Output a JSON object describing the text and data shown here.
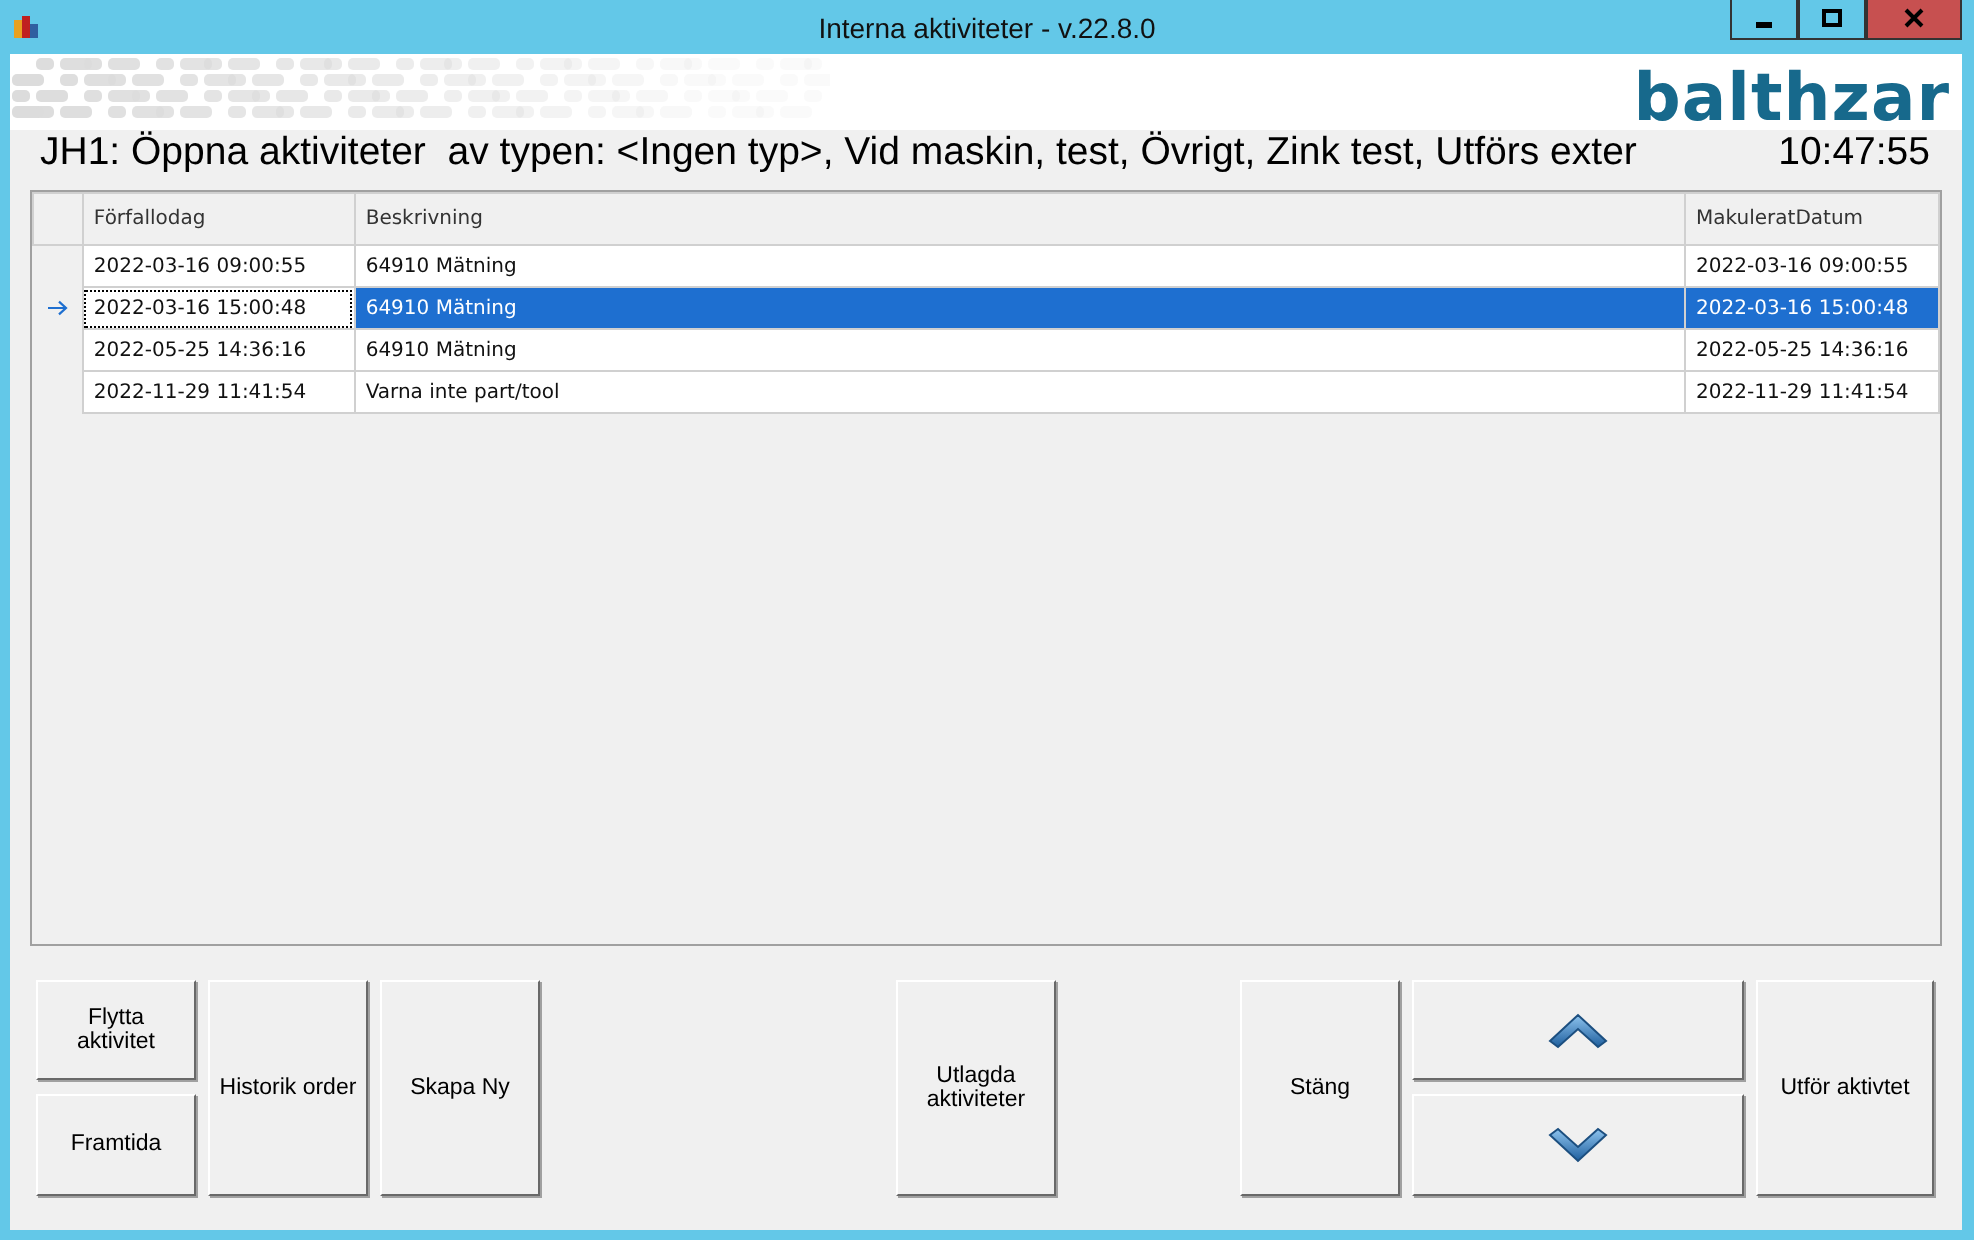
{
  "window": {
    "title": "Interna aktiviteter - v.22.8.0",
    "controls": [
      {
        "kind": "minimize"
      },
      {
        "kind": "maximize"
      },
      {
        "kind": "close"
      }
    ]
  },
  "logo": "balthzar",
  "heading": "JH1: Öppna aktiviteter  av typen: <Ingen typ>, Vid maskin, test, Övrigt, Zink test, Utförs exter",
  "clock": "10:47:55",
  "table": {
    "columns": [
      "Förfallodag",
      "Beskrivning",
      "MakuleratDatum"
    ],
    "rows": [
      {
        "cells": [
          "2022-03-16 09:00:55",
          "64910 Mätning",
          "2022-03-16 09:00:55"
        ],
        "selected": false
      },
      {
        "cells": [
          "2022-03-16 15:00:48",
          "64910 Mätning",
          "2022-03-16 15:00:48"
        ],
        "selected": true
      },
      {
        "cells": [
          "2022-05-25 14:36:16",
          "64910 Mätning",
          "2022-05-25 14:36:16"
        ],
        "selected": false
      },
      {
        "cells": [
          "2022-11-29 11:41:54",
          "Varna inte part/tool",
          "2022-11-29 11:41:54"
        ],
        "selected": false
      }
    ]
  },
  "buttons": [
    {
      "kind": "text",
      "label": "Flytta aktivitet"
    },
    {
      "kind": "text",
      "label": "Framtida"
    },
    {
      "kind": "text",
      "label": "Historik order"
    },
    {
      "kind": "text",
      "label": "Skapa Ny"
    },
    {
      "kind": "text",
      "label": "Utlagda aktiviteter"
    },
    {
      "kind": "text",
      "label": "Stäng"
    },
    {
      "kind": "up"
    },
    {
      "kind": "down"
    },
    {
      "kind": "text",
      "label": "Utför aktivtet"
    }
  ]
}
